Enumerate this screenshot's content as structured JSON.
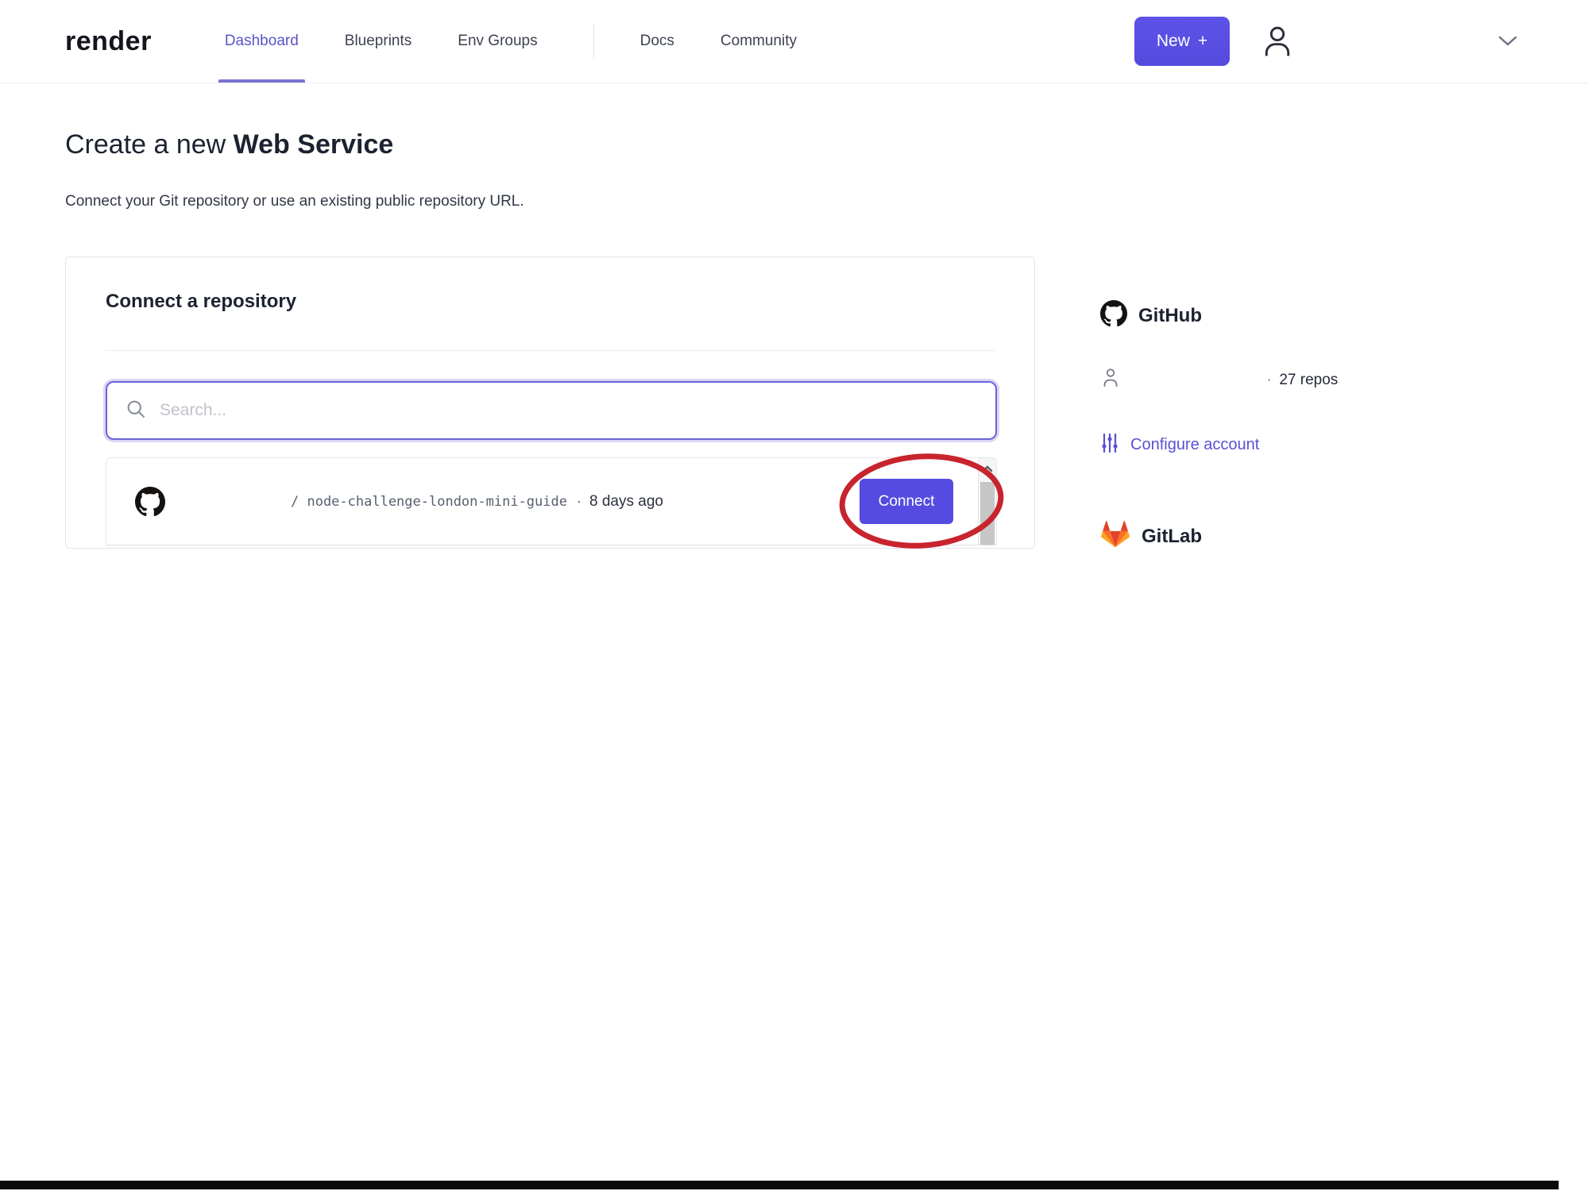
{
  "nav": {
    "logo": "render",
    "items": [
      {
        "label": "Dashboard",
        "active": true
      },
      {
        "label": "Blueprints",
        "active": false
      },
      {
        "label": "Env Groups",
        "active": false
      },
      {
        "label": "Docs",
        "active": false
      },
      {
        "label": "Community",
        "active": false
      }
    ],
    "new_button_label": "New",
    "new_button_plus": "+"
  },
  "page": {
    "title_prefix": "Create a new ",
    "title_emphasis": "Web Service",
    "subtitle": "Connect your Git repository or use an existing public repository URL."
  },
  "card": {
    "heading": "Connect a repository",
    "search": {
      "placeholder": "Search...",
      "value": ""
    },
    "repos": [
      {
        "path": "/ node-challenge-london-mini-guide",
        "separator": "·",
        "updated": "8 days ago",
        "connect_label": "Connect"
      }
    ]
  },
  "sidebar": {
    "github": {
      "title": "GitHub",
      "bullet": "·",
      "repo_count": "27 repos",
      "configure_label": "Configure account"
    },
    "gitlab": {
      "title": "GitLab"
    }
  },
  "colors": {
    "accent": "#554be0",
    "nav_active": "#5a54c8",
    "annotation_red": "#c8242e",
    "gitlab_orange": "#fc6d26",
    "gitlab_red": "#e24329",
    "gitlab_yellow": "#fca326"
  }
}
